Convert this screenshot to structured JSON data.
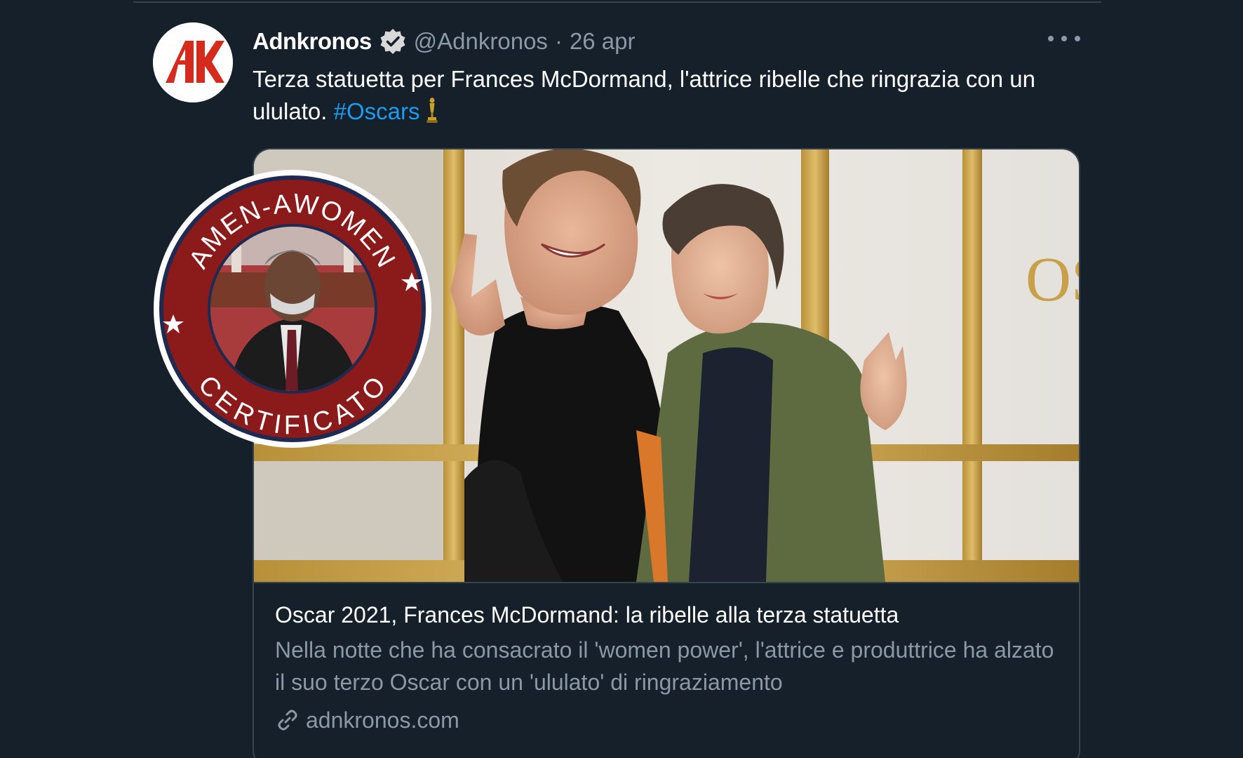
{
  "tweet": {
    "author": {
      "display_name": "Adnkronos",
      "handle": "@Adnkronos",
      "separator": "·",
      "date": "26 apr",
      "verified": true,
      "avatar_icon": "adnkronos-logo"
    },
    "text": {
      "body": "Terza statuetta per Frances McDormand, l'attrice ribelle che ringrazia con un ululato.",
      "hashtag": "#Oscars",
      "trailing_emoji": "trophy-icon"
    },
    "more_icon": "more-horizontal-icon"
  },
  "link_card": {
    "title": "Oscar 2021, Frances McDormand: la ribelle alla terza statuetta",
    "description": "Nella notte che ha consacrato il 'women power', l'attrice e produttrice ha alzato il suo terzo Oscar con un 'ululato' di ringraziamento",
    "domain": "adnkronos.com",
    "domain_icon": "link-icon",
    "backdrop_text": "OS"
  },
  "stamp": {
    "top_text": "AMEN-AWOMEN",
    "bottom_text": "CERTIFICATO",
    "ring_color": "#8b1a1a",
    "star_icon": "star-icon"
  },
  "colors": {
    "background": "#15202b",
    "text_primary": "#ffffff",
    "text_secondary": "#8b98a5",
    "link": "#1d9bf0",
    "border": "#38444d",
    "brand_red": "#d52b1e"
  }
}
